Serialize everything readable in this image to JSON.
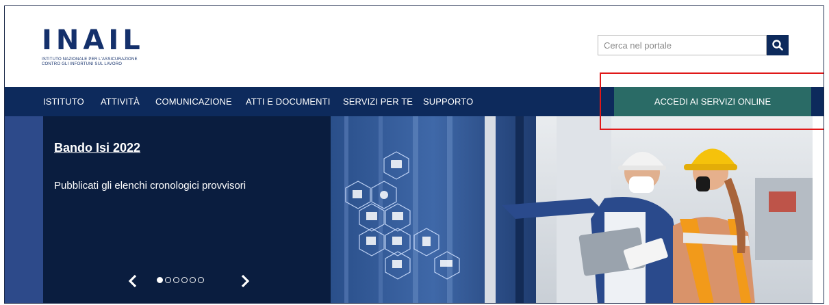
{
  "header": {
    "logo_text": "INAIL",
    "logo_subtitle_line1": "ISTITUTO NAZIONALE PER L'ASSICURAZIONE",
    "logo_subtitle_line2": "CONTRO GLI INFORTUNI SUL LAVORO",
    "search": {
      "placeholder": "Cerca nel portale",
      "icon": "search-icon"
    }
  },
  "nav": {
    "items": [
      {
        "label": "ISTITUTO"
      },
      {
        "label": "ATTIVITÀ"
      },
      {
        "label": "COMUNICAZIONE"
      },
      {
        "label": "ATTI E DOCUMENTI"
      },
      {
        "label": "SERVIZI PER TE"
      },
      {
        "label": "SUPPORTO"
      }
    ],
    "cta_label": "ACCEDI AI SERVIZI ONLINE"
  },
  "hero": {
    "title": "Bando Isi 2022",
    "subtitle": "Pubblicati gli elenchi cronologici provvisori",
    "carousel": {
      "prev": "‹",
      "next": "›",
      "total_slides": 6,
      "active_slide": 1
    }
  },
  "colors": {
    "brand_navy": "#0d2a5c",
    "cta_teal": "#2a6b66",
    "highlight_red": "#e01818"
  }
}
